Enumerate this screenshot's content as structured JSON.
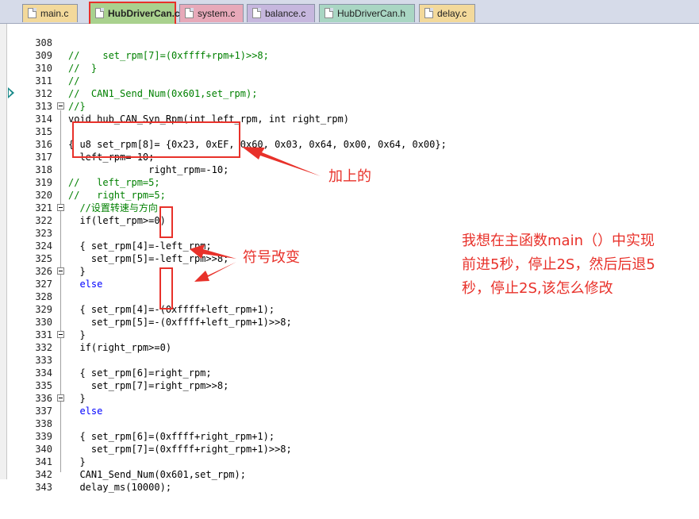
{
  "tabs": [
    {
      "label": "main.c",
      "color": "#f3d99b"
    },
    {
      "label": "HubDriverCan.c",
      "color": "#a9d18e",
      "active": true
    },
    {
      "label": "system.c",
      "color": "#e7a9b9"
    },
    {
      "label": "balance.c",
      "color": "#c6b7de"
    },
    {
      "label": "HubDriverCan.h",
      "color": "#a9d6c3"
    },
    {
      "label": "delay.c",
      "color": "#f3d99b"
    }
  ],
  "lines": [
    {
      "n": "308",
      "text": "//    set_rpm[7]=(0xffff+rpm+1)>>8;"
    },
    {
      "n": "309",
      "text": "//  }"
    },
    {
      "n": "310",
      "text": "//"
    },
    {
      "n": "311",
      "text": "//  CAN1_Send_Num(0x601,set_rpm);"
    },
    {
      "n": "312",
      "text": "//}"
    },
    {
      "n": "313",
      "text": "void hub_CAN_Syn_Rpm(int left_rpm, int right_rpm)"
    },
    {
      "n": "314",
      "text": "{"
    },
    {
      "n": "315",
      "text": "  u8 set_rpm[8]= {0x23, 0xEF, 0x60, 0x03, 0x64, 0x00, 0x64, 0x00};"
    },
    {
      "n": "316",
      "text": "  left_rpm=-10;"
    },
    {
      "n": "317",
      "text": "              right_rpm=-10;"
    },
    {
      "n": "318",
      "text": "//   left_rpm=5;"
    },
    {
      "n": "319",
      "text": "//   right_rpm=5;"
    },
    {
      "n": "320",
      "text": "  //设置转速与方向"
    },
    {
      "n": "321",
      "text": "  if(left_rpm>=0)"
    },
    {
      "n": "322",
      "text": "  {"
    },
    {
      "n": "323",
      "text": "    set_rpm[4]=-left_rpm;"
    },
    {
      "n": "324",
      "text": "    set_rpm[5]=-left_rpm>>8;"
    },
    {
      "n": "325",
      "text": "  }"
    },
    {
      "n": "326",
      "text": "  else"
    },
    {
      "n": "327",
      "text": "  {"
    },
    {
      "n": "328",
      "text": "    set_rpm[4]=-(0xffff+left_rpm+1);"
    },
    {
      "n": "329",
      "text": "    set_rpm[5]=-(0xffff+left_rpm+1)>>8;"
    },
    {
      "n": "330",
      "text": "  }"
    },
    {
      "n": "331",
      "text": "  if(right_rpm>=0)"
    },
    {
      "n": "332",
      "text": "  {"
    },
    {
      "n": "333",
      "text": "    set_rpm[6]=right_rpm;"
    },
    {
      "n": "334",
      "text": "    set_rpm[7]=right_rpm>>8;"
    },
    {
      "n": "335",
      "text": "  }"
    },
    {
      "n": "336",
      "text": "  else"
    },
    {
      "n": "337",
      "text": "  {"
    },
    {
      "n": "338",
      "text": "    set_rpm[6]=(0xffff+right_rpm+1);"
    },
    {
      "n": "339",
      "text": "    set_rpm[7]=(0xffff+right_rpm+1)>>8;"
    },
    {
      "n": "340",
      "text": "  }"
    },
    {
      "n": "341",
      "text": "  CAN1_Send_Num(0x601,set_rpm);"
    },
    {
      "n": "342",
      "text": "  delay_ms(10000);"
    },
    {
      "n": "343",
      "text": ""
    }
  ],
  "annotations": {
    "added": "加上的",
    "sign_changed": "符号改变",
    "question_line1": "我想在主函数main（）中实现",
    "question_line2": "前进5秒，停止2S，然后后退5",
    "question_line3": "秒，停止2S,该怎么修改"
  },
  "colors": {
    "annotation": "#e8312a",
    "comment": "#008000",
    "keyword": "#0000ff",
    "number": "#800080"
  }
}
